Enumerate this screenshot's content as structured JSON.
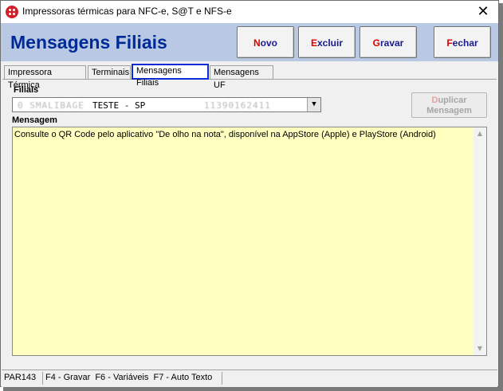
{
  "window": {
    "title": "Impressoras térmicas para NFC-e, S@T e NFS-e",
    "close_glyph": "✕"
  },
  "header": {
    "title": "Mensagens Filiais",
    "buttons": {
      "novo": {
        "hot": "N",
        "rest": "ovo"
      },
      "excluir": {
        "hot": "E",
        "rest": "xcluir"
      },
      "gravar": {
        "hot": "G",
        "rest": "ravar"
      },
      "fechar": {
        "hot": "F",
        "rest": "echar"
      }
    }
  },
  "tabs": [
    {
      "label": "Impressora Térmica"
    },
    {
      "label": "Terminais"
    },
    {
      "label": "Mensagens Filiais",
      "active": true
    },
    {
      "label": "Mensagens UF"
    }
  ],
  "filiais": {
    "label": "Filiais",
    "selected_value": "TESTE - SP",
    "blurred_prefix": "0   SMALIBAGE",
    "blurred_suffix": "11390162411"
  },
  "duplicar_button": {
    "hot": "D",
    "line1_rest": "uplicar",
    "line2": "Mensagem"
  },
  "mensagem": {
    "label": "Mensagem",
    "text": "Consulte o QR Code pelo aplicativo \"De olho na nota\", disponível na AppStore (Apple) e PlayStore (Android)"
  },
  "statusbar": {
    "code": "PAR143",
    "shortcuts": "F4 - Gravar  F6 - Variáveis  F7 - Auto Texto"
  },
  "colors": {
    "header_bg": "#b9c9e4",
    "title_color": "#002b96",
    "hotkey_red": "#e00000",
    "memo_bg": "#ffffc0",
    "active_tab_border": "#0a2bd8"
  },
  "icons": {
    "app": "app-logo-icon",
    "close": "close-icon",
    "dropdown": "chevron-down-icon",
    "scroll_up": "scroll-up-icon",
    "scroll_down": "scroll-down-icon"
  }
}
